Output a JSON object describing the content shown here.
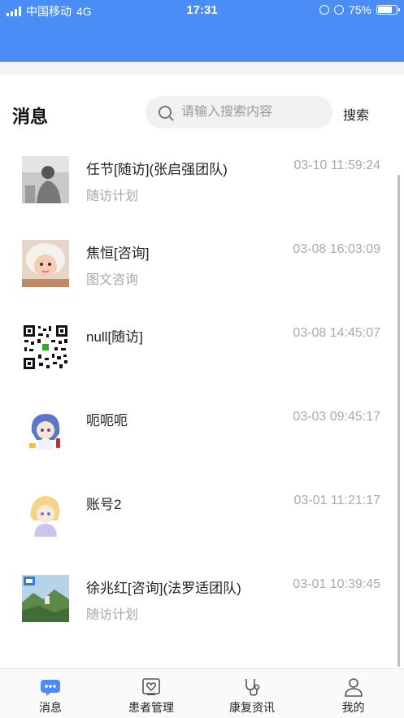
{
  "status_bar": {
    "carrier": "中国移动",
    "network": "4G",
    "time": "17:31",
    "battery": "75%"
  },
  "header": {
    "title": "消息",
    "search_placeholder": "请输入搜索内容",
    "search_button": "搜索"
  },
  "messages": [
    {
      "title": "任节[随访](张启强团队)",
      "subtitle": "随访计划",
      "time": "03-10 11:59:24",
      "avatar": "photo-person-gray"
    },
    {
      "title": "焦恒[咨询]",
      "subtitle": "图文咨询",
      "time": "03-08 16:03:09",
      "avatar": "photo-baby"
    },
    {
      "title": "null[随访]",
      "subtitle": "",
      "time": "03-08 14:45:07",
      "avatar": "qr-code"
    },
    {
      "title": "呃呃呃",
      "subtitle": "",
      "time": "03-03 09:45:17",
      "avatar": "anime-girl-blue"
    },
    {
      "title": "账号2",
      "subtitle": "",
      "time": "03-01 11:21:17",
      "avatar": "anime-boy-blond"
    },
    {
      "title": "徐兆红[咨询](法罗适团队)",
      "subtitle": "随访计划",
      "time": "03-01 10:39:45",
      "avatar": "photo-landscape"
    }
  ],
  "tabs": [
    {
      "label": "消息",
      "icon": "chat-bubble-icon",
      "active": true
    },
    {
      "label": "患者管理",
      "icon": "heart-card-icon",
      "active": false
    },
    {
      "label": "康复资讯",
      "icon": "stethoscope-icon",
      "active": false
    },
    {
      "label": "我的",
      "icon": "user-icon",
      "active": false
    }
  ],
  "colors": {
    "brand": "#4a8df6",
    "subtext": "#a8a8a8"
  }
}
